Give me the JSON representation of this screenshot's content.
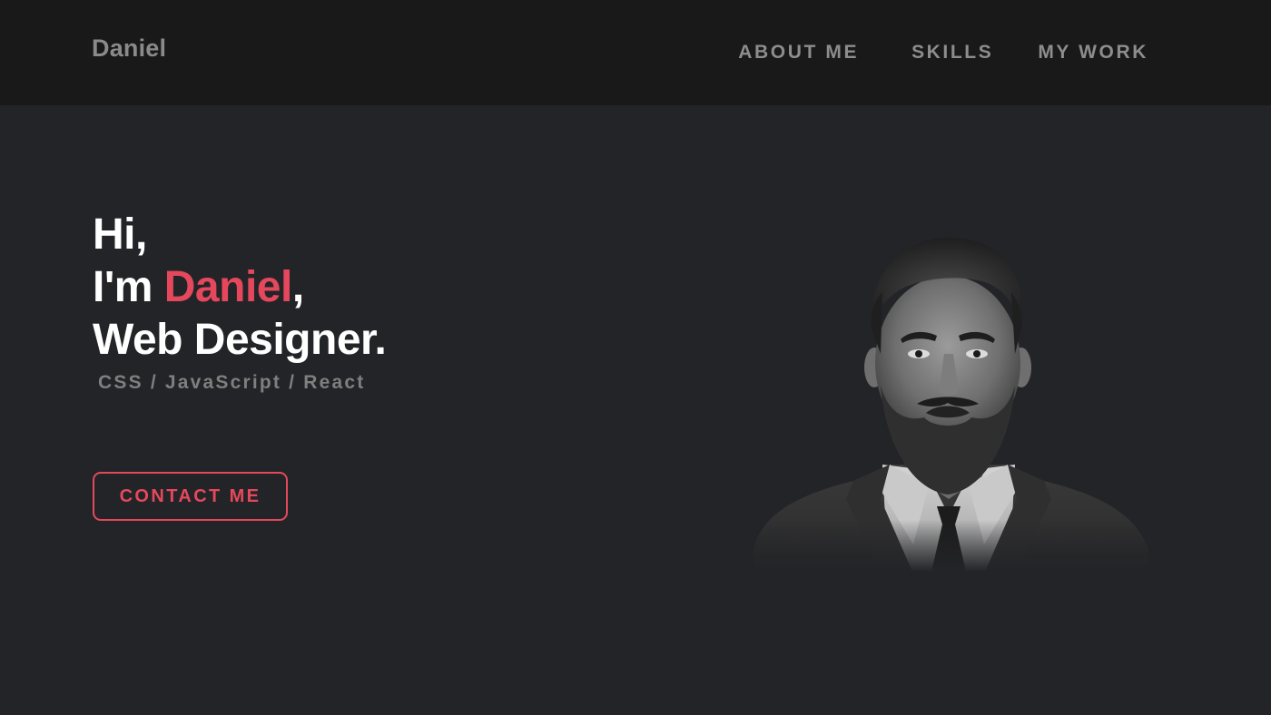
{
  "navbar": {
    "brand": "Daniel",
    "links": [
      {
        "label": "ABOUT ME"
      },
      {
        "label": "SKILLS"
      },
      {
        "label": "MY WORK"
      }
    ]
  },
  "hero": {
    "greeting": "Hi,",
    "intro_prefix": "I'm ",
    "name": "Daniel",
    "intro_suffix": ",",
    "role": "Web Designer.",
    "skills": "CSS / JavaScript / React",
    "cta_label": "CONTACT ME",
    "portrait_icon": "portrait-photo"
  },
  "colors": {
    "accent": "#e5485d",
    "navbar_bg": "#191919",
    "page_bg": "#232427"
  }
}
